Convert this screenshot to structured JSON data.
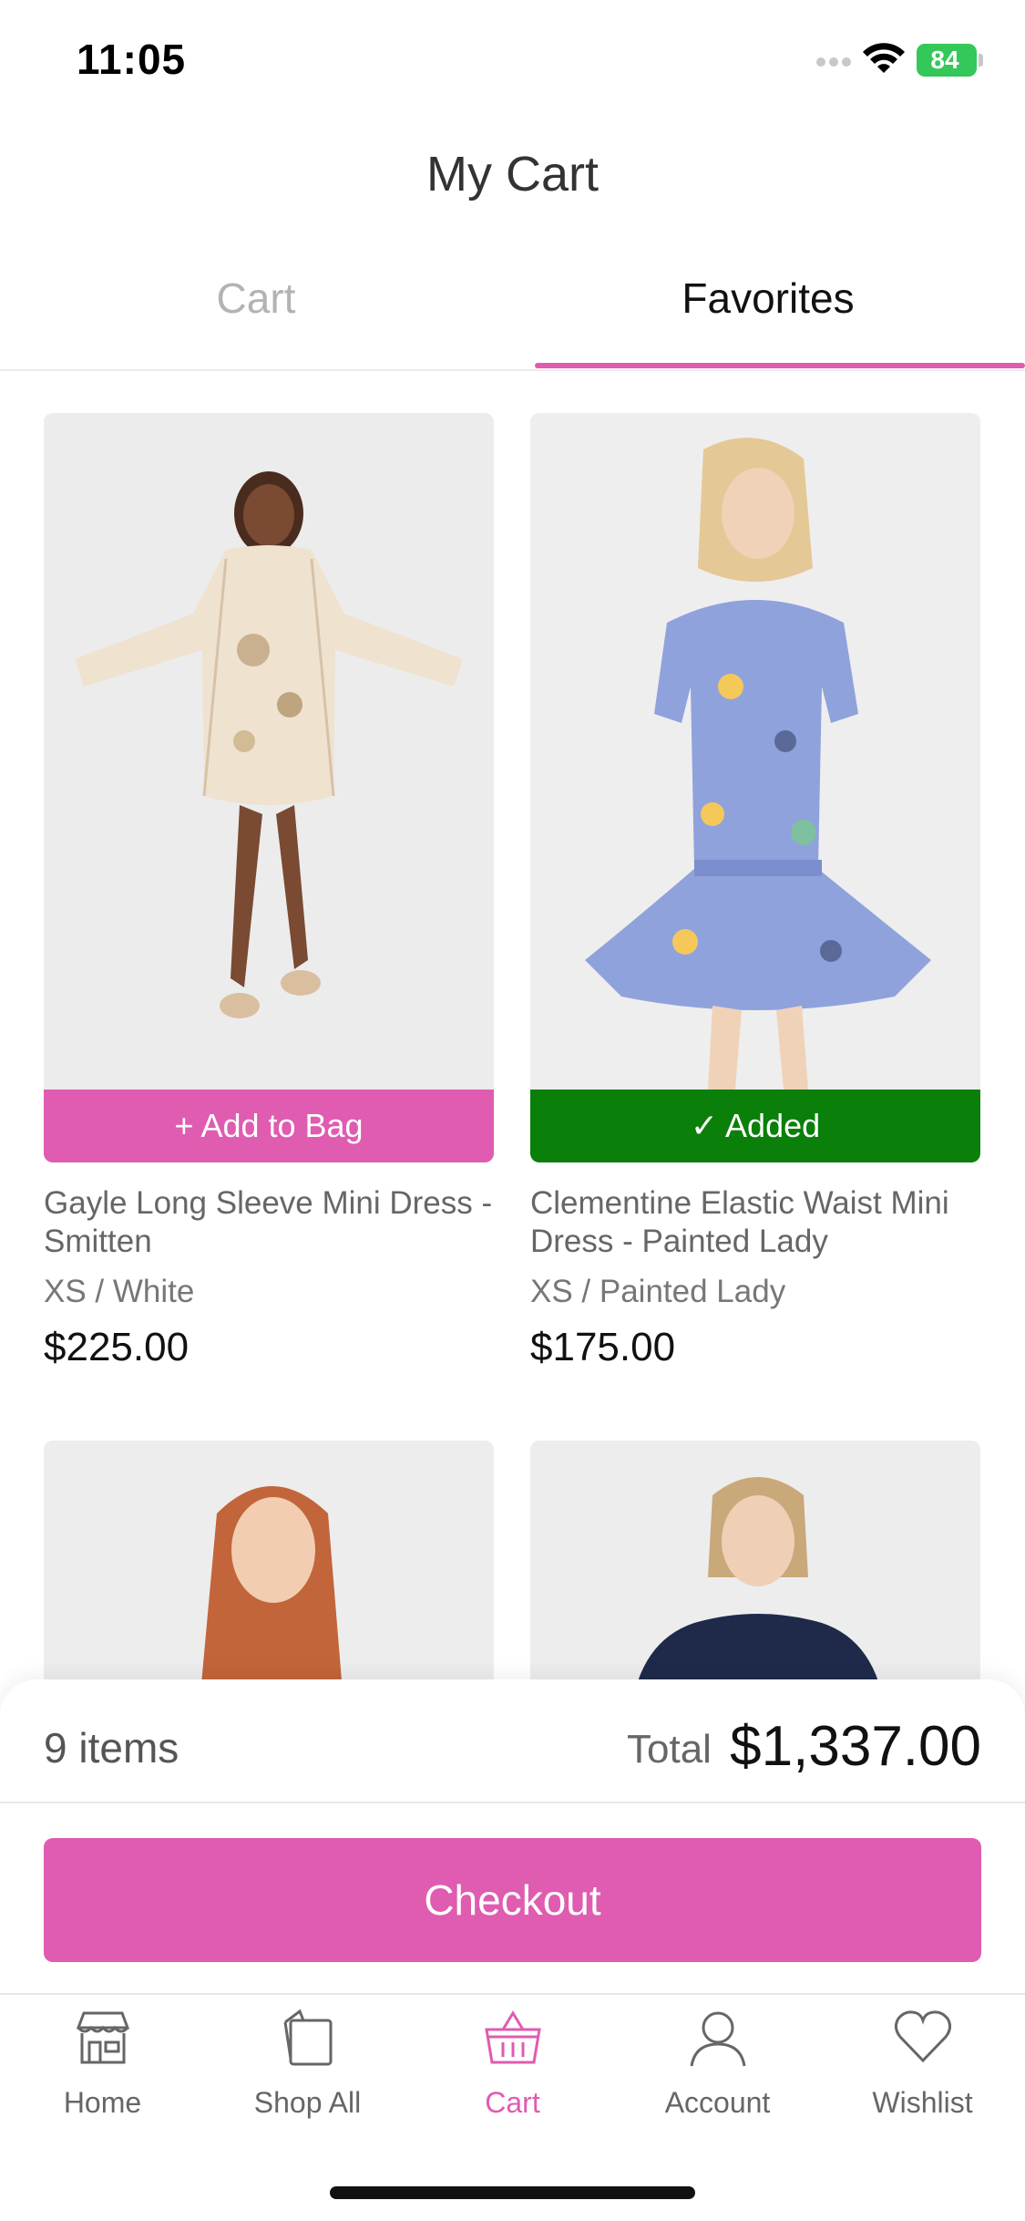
{
  "status_bar": {
    "time": "11:05",
    "battery": "84"
  },
  "header": {
    "title": "My Cart"
  },
  "tabs": [
    {
      "label": "Cart",
      "active": false
    },
    {
      "label": "Favorites",
      "active": true
    }
  ],
  "products": [
    {
      "name": "Gayle Long Sleeve Mini Dress - Smitten",
      "variant": "XS / White",
      "price": "$225.00",
      "button": "+ Add to Bag",
      "state": "add"
    },
    {
      "name": "Clementine Elastic Waist Mini Dress - Painted Lady",
      "variant": "XS / Painted Lady",
      "price": "$175.00",
      "button": "✓ Added",
      "state": "added"
    }
  ],
  "summary": {
    "items": "9 items",
    "total_label": "Total",
    "total_value": "$1,337.00",
    "checkout_label": "Checkout"
  },
  "nav": [
    {
      "label": "Home",
      "icon": "storefront-icon"
    },
    {
      "label": "Shop All",
      "icon": "shopping-bag-icon"
    },
    {
      "label": "Cart",
      "icon": "basket-icon",
      "active": true
    },
    {
      "label": "Account",
      "icon": "user-icon"
    },
    {
      "label": "Wishlist",
      "icon": "heart-icon"
    }
  ],
  "colors": {
    "accent": "#df5cb0",
    "added": "#0a7f0a"
  }
}
